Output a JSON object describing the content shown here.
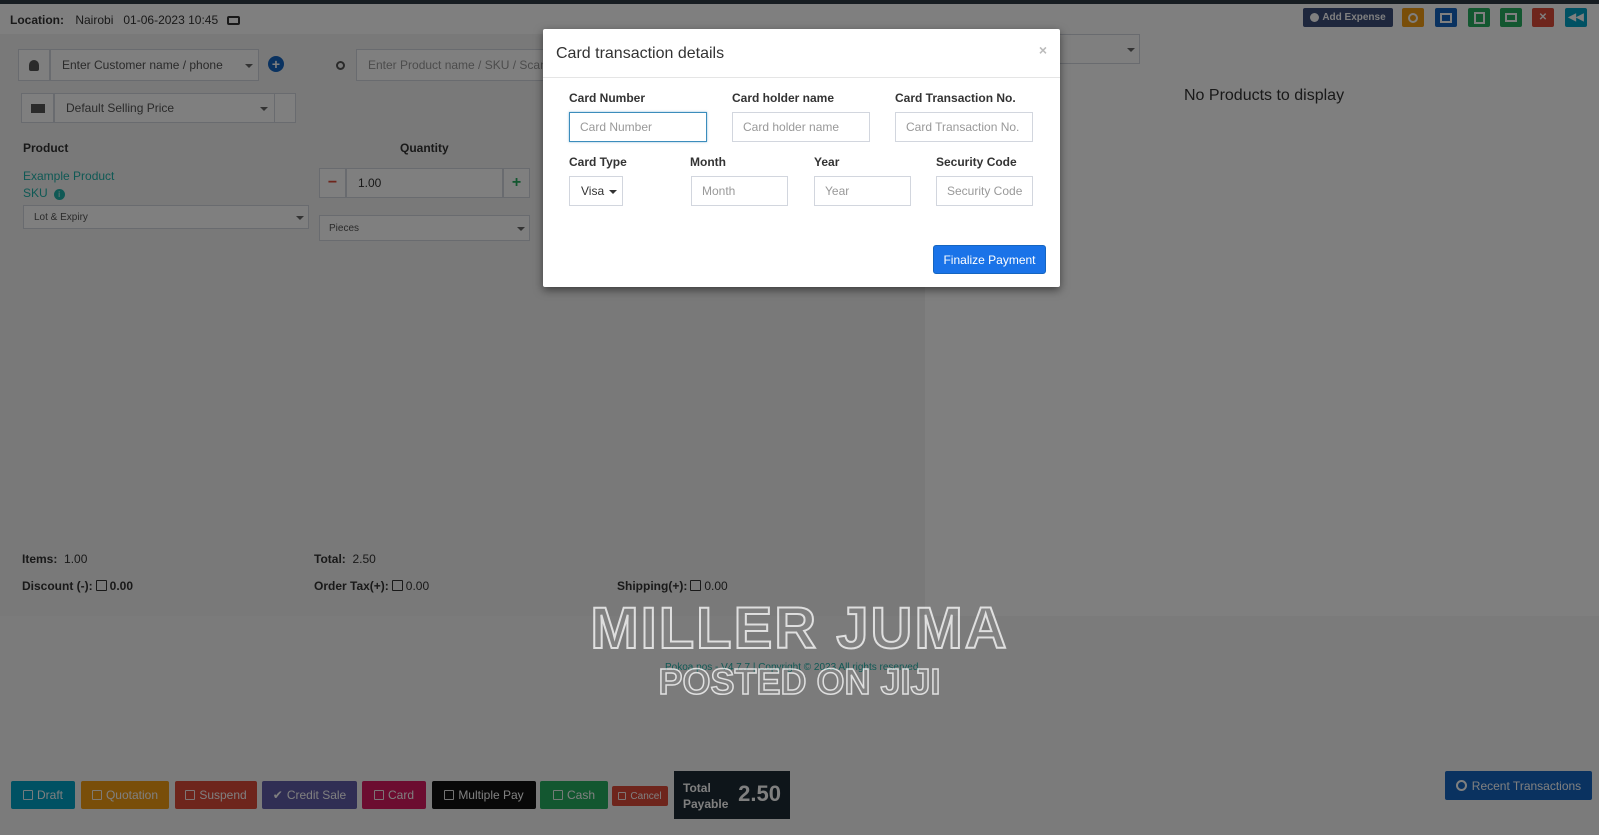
{
  "topbar": {
    "location_label": "Location:",
    "location_value": "Nairobi",
    "datetime": "01-06-2023 10:45",
    "add_expense_label": "Add Expense",
    "icon_buttons": [
      {
        "name": "clock-icon",
        "color": "#f39c12"
      },
      {
        "name": "calculator-icon",
        "color": "#1565c0"
      },
      {
        "name": "calculator-alt-icon",
        "color": "#27ae60"
      },
      {
        "name": "briefcase-icon",
        "color": "#27ae60"
      },
      {
        "name": "close-register-icon",
        "color": "#dd4b39"
      },
      {
        "name": "back-icon",
        "color": "#00a2c7"
      }
    ]
  },
  "customer": {
    "placeholder": "Enter Customer name / phone"
  },
  "product_search": {
    "placeholder": "Enter Product name / SKU / Scan bar code"
  },
  "price_group": {
    "selected": "Default Selling Price"
  },
  "table": {
    "headers": {
      "product": "Product",
      "quantity": "Quantity"
    },
    "rows": [
      {
        "name": "Example Product",
        "sku": "SKU",
        "lot_placeholder": "Lot & Expiry",
        "quantity": "1.00",
        "unit": "Pieces"
      }
    ]
  },
  "summary": {
    "items_label": "Items:",
    "items_value": "1.00",
    "total_label": "Total:",
    "total_value": "2.50",
    "discount_label": "Discount (-):",
    "discount_value": "0.00",
    "tax_label": "Order Tax(+):",
    "tax_value": "0.00",
    "shipping_label": "Shipping(+):",
    "shipping_value": "0.00"
  },
  "right_panel": {
    "empty_message": "No Products to display"
  },
  "footer": {
    "copyright": "Pokoa pos - V4.7.7 | Copyright © 2023 All rights reserved."
  },
  "actions": {
    "draft": "Draft",
    "quotation": "Quotation",
    "suspend": "Suspend",
    "credit_sale": "Credit Sale",
    "card": "Card",
    "multiple_pay": "Multiple Pay",
    "cash": "Cash",
    "cancel": "Cancel",
    "total_payable_label": "Total Payable",
    "total_payable_value": "2.50",
    "recent_transactions": "Recent Transactions"
  },
  "modal": {
    "title": "Card transaction details",
    "close": "×",
    "card_number_label": "Card Number",
    "card_number_placeholder": "Card Number",
    "holder_label": "Card holder name",
    "holder_placeholder": "Card holder name",
    "txn_label": "Card Transaction No.",
    "txn_placeholder": "Card Transaction No.",
    "type_label": "Card Type",
    "type_value": "Visa",
    "month_label": "Month",
    "month_placeholder": "Month",
    "year_label": "Year",
    "year_placeholder": "Year",
    "security_label": "Security Code",
    "security_placeholder": "Security Code",
    "finalize_label": "Finalize Payment"
  },
  "watermark": {
    "line1": "MILLER JUMA",
    "line2": "POSTED ON JIJI"
  }
}
